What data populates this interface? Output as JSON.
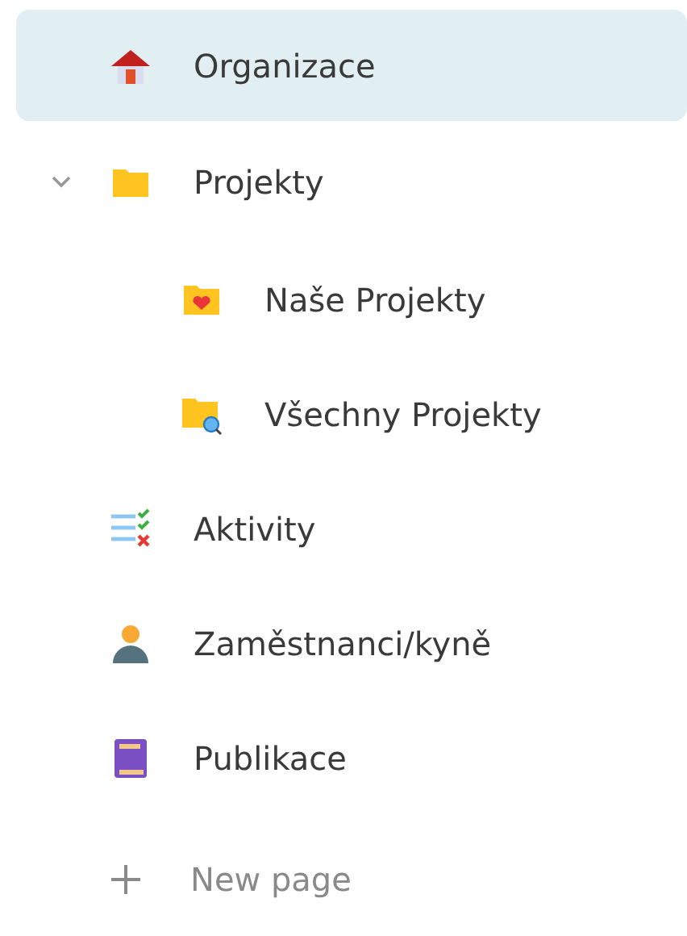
{
  "sidebar": {
    "items": [
      {
        "label": "Organizace",
        "kind": "house",
        "selected": true
      },
      {
        "label": "Projekty",
        "kind": "folder",
        "selected": false,
        "expanded": true,
        "children": [
          {
            "label": "Naše Projekty",
            "kind": "folder-heart",
            "selected": false
          },
          {
            "label": "Všechny Projekty",
            "kind": "folder-search",
            "selected": false
          }
        ]
      },
      {
        "label": "Aktivity",
        "kind": "checklist",
        "selected": false
      },
      {
        "label": "Zaměstnanci/kyně",
        "kind": "person",
        "selected": false
      },
      {
        "label": "Publikace",
        "kind": "book",
        "selected": false
      }
    ],
    "new_page": {
      "label": "New page"
    }
  }
}
